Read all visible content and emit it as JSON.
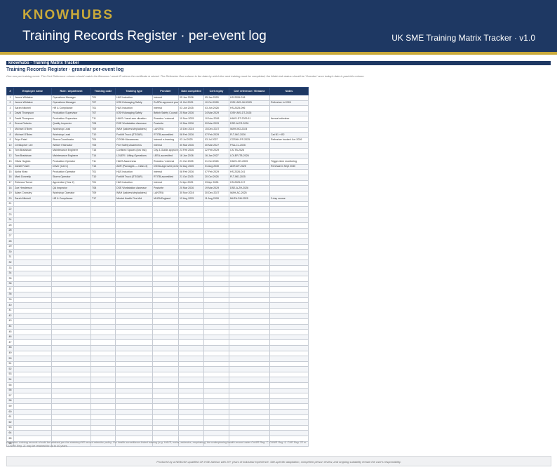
{
  "header": {
    "brand": "KNOWHUBS",
    "title": "Training Records Register · per-event log",
    "right_label": "UK SME Training Matrix Tracker · v1.0"
  },
  "sheet": {
    "bar_label": "knowhubs · Training Matrix Tracker",
    "title": "Training Records Register · granular per-event log",
    "description": "One row per training event. The Cert Reference column should match the filename / asset ID where the certificate is stored. The Refresher Due column is the date by which the next training must be completed; the Matrix tab status should be 'Overdue' once today's date is past this column."
  },
  "columns": [
    "#",
    "Employee name",
    "Role / department",
    "Training code",
    "Training type",
    "Provider",
    "Date completed",
    "Cert expiry",
    "Cert reference / filename",
    "Notes"
  ],
  "rows": [
    {
      "n": "1",
      "name": "James Whitaker",
      "role": "Operations Manager",
      "code": "T01",
      "type": "H&S Induction",
      "provider": "Internal",
      "done": "05 Jan 2026",
      "expiry": "05 Jan 2029",
      "ref": "HS-2026-018",
      "notes": ""
    },
    {
      "n": "2",
      "name": "James Whitaker",
      "role": "Operations Manager",
      "code": "T07",
      "type": "IOSH Managing Safely",
      "provider": "RoSPA-approved provider",
      "done": "11 Oct 2025",
      "expiry": "10 Oct 2028",
      "ref": "IOSH-MS-JW-2025",
      "notes": "Refresher in 2028"
    },
    {
      "n": "3",
      "name": "Sarah Mitchell",
      "role": "HR & Compliance",
      "code": "T01",
      "type": "H&S Induction",
      "provider": "Internal",
      "done": "03 Jun 2025",
      "expiry": "03 Jun 2028",
      "ref": "HS-2025-096",
      "notes": ""
    },
    {
      "n": "4",
      "name": "David Thompson",
      "role": "Production Supervisor",
      "code": "T07",
      "type": "IOSH Managing Safely",
      "provider": "British Safety Council",
      "done": "25 Mar 2026",
      "expiry": "24 Mar 2029",
      "ref": "IOSH-MS-DT-2026",
      "notes": ""
    },
    {
      "n": "5",
      "name": "David Thompson",
      "role": "Production Supervisor",
      "code": "T11",
      "type": "HAVS / hand-arm vibration",
      "provider": "Reantec / external",
      "done": "10 Nov 2025",
      "expiry": "10 Nov 2026",
      "ref": "HAVS-DT-2025-11",
      "notes": "Annual refresher"
    },
    {
      "n": "6",
      "name": "Emma Roberts",
      "role": "Quality Inspector",
      "code": "T08",
      "type": "DSE Workstation Assessor",
      "provider": "Posturite",
      "done": "10 Mar 2026",
      "expiry": "09 Mar 2029",
      "ref": "DSE-A-ER-2026",
      "notes": ""
    },
    {
      "n": "7",
      "name": "Michael O'Brien",
      "role": "Workshop Lead",
      "code": "T09",
      "type": "WAH (ladders/stepladders)",
      "provider": "LANTRA",
      "done": "15 Dec 2024",
      "expiry": "15 Dec 2027",
      "ref": "WAH-MO-2024",
      "notes": ""
    },
    {
      "n": "8",
      "name": "Michael O'Brien",
      "role": "Workshop Lead",
      "code": "T10",
      "type": "Forklift Truck (ITSSAR)",
      "provider": "RTITB-accredited",
      "done": "08 Feb 2026",
      "expiry": "07 Feb 2029",
      "ref": "FLT-MO-2026",
      "notes": "Cat B1 + B2"
    },
    {
      "n": "9",
      "name": "Priya Patel",
      "role": "Stores Coordinator",
      "code": "T04",
      "type": "COSHH Awareness",
      "provider": "Internal e-learning",
      "done": "03 Jul 2025",
      "expiry": "03 Jul 2027",
      "ref": "COSHH-PP-2025",
      "notes": "Refresher booked Jun 2026"
    },
    {
      "n": "10",
      "name": "Christopher Lee",
      "role": "Welder Fabricator",
      "code": "T05",
      "type": "Fire Safety Awareness",
      "provider": "Internal",
      "done": "30 Mar 2026",
      "expiry": "30 Mar 2027",
      "ref": "FSA-CL-2026",
      "notes": ""
    },
    {
      "n": "11",
      "name": "Tom Bradshaw",
      "role": "Maintenance Engineer",
      "code": "T15",
      "type": "Confined Spaces (low risk)",
      "provider": "City & Guilds approved",
      "done": "23 Feb 2026",
      "expiry": "22 Feb 2029",
      "ref": "CS-TB-2026",
      "notes": ""
    },
    {
      "n": "12",
      "name": "Tom Bradshaw",
      "role": "Maintenance Engineer",
      "code": "T14",
      "type": "LOLER / Lifting Operations",
      "provider": "LEEA-accredited",
      "done": "16 Jan 2026",
      "expiry": "16 Jan 2027",
      "ref": "LOLER-TB-2026",
      "notes": ""
    },
    {
      "n": "13",
      "name": "Olivia Hughes",
      "role": "Production Operator",
      "code": "T11",
      "type": "HAVS Awareness",
      "provider": "Reantec / external",
      "done": "21 Oct 2025",
      "expiry": "21 Oct 2026",
      "ref": "HAVS-OH-2025",
      "notes": "Trigger-time monitoring"
    },
    {
      "n": "14",
      "name": "Daniel Foster",
      "role": "Driver (Cat C)",
      "code": "T13",
      "type": "ADR (Packages — Class 3)",
      "provider": "DGSA-approved provider",
      "done": "02 Aug 2025",
      "expiry": "01 Aug 2030",
      "ref": "ADR-DF-2025",
      "notes": "Renewal in Sept 2030"
    },
    {
      "n": "15",
      "name": "Aisha Khan",
      "role": "Production Operator",
      "code": "T01",
      "type": "H&S Induction",
      "provider": "Internal",
      "done": "08 Feb 2026",
      "expiry": "07 Feb 2029",
      "ref": "HS-2026-041",
      "notes": ""
    },
    {
      "n": "16",
      "name": "Mark Donnelly",
      "role": "Stores Operator",
      "code": "T10",
      "type": "Forklift Truck (ITSSAR)",
      "provider": "RTITB-accredited",
      "done": "21 Oct 2025",
      "expiry": "20 Oct 2028",
      "ref": "FLT-MD-2025",
      "notes": ""
    },
    {
      "n": "17",
      "name": "Rebecca Turner",
      "role": "Apprentice (Year 2)",
      "code": "T01",
      "type": "H&S Induction",
      "provider": "Internal",
      "done": "24 Apr 2025",
      "expiry": "23 Apr 2028",
      "ref": "HS-2025-017",
      "notes": ""
    },
    {
      "n": "18",
      "name": "Zoe Henderson",
      "role": "QA Inspector",
      "code": "T08",
      "type": "DSE Workstation Assessor",
      "provider": "Posturite",
      "done": "20 Mar 2026",
      "expiry": "19 Mar 2029",
      "ref": "DSE-A-ZH-2026",
      "notes": ""
    },
    {
      "n": "19",
      "name": "Adam Crossley",
      "role": "Workshop Operator",
      "code": "T09",
      "type": "WAH (ladders/stepladders)",
      "provider": "LANTRA",
      "done": "30 Nov 2024",
      "expiry": "30 Dec 2027",
      "ref": "WAH-AC-2025",
      "notes": ""
    },
    {
      "n": "20",
      "name": "Sarah Mitchell",
      "role": "HR & Compliance",
      "code": "T17",
      "type": "Mental Health First Aid",
      "provider": "MHFA England",
      "done": "12 Aug 2025",
      "expiry": "11 Aug 2028",
      "ref": "MHFA-SM-2025",
      "notes": "2-day course"
    }
  ],
  "empty_row_numbers": [
    "21",
    "22",
    "23",
    "24",
    "25",
    "26",
    "27",
    "28",
    "29",
    "30",
    "31",
    "32",
    "33",
    "34",
    "35",
    "36",
    "37",
    "38",
    "39",
    "40",
    "41",
    "42",
    "43",
    "44",
    "45",
    "46",
    "47",
    "48",
    "49",
    "50",
    "51",
    "52",
    "53",
    "54",
    "55",
    "56",
    "57",
    "58",
    "59",
    "60",
    "61",
    "62",
    "63",
    "64",
    "65",
    "66"
  ],
  "footnote": "Retention: training records should be retained per the statutory/HR record retention policy. For health-surveillance-linked training (e.g. HAVS, noise, asbestos, respiratory) the underpinning health record under CoWR Reg. 7, CAWR Reg. 9, CAR Reg. 22 or COSHH Reg. 11 may be retained for up to 40 years.",
  "footer": "Produced by a NEBOSH-qualified UK HSE Advisor with 20+ years of industrial experience. Site-specific adaptation, competent person review, and ongoing suitability remain the user's responsibility."
}
